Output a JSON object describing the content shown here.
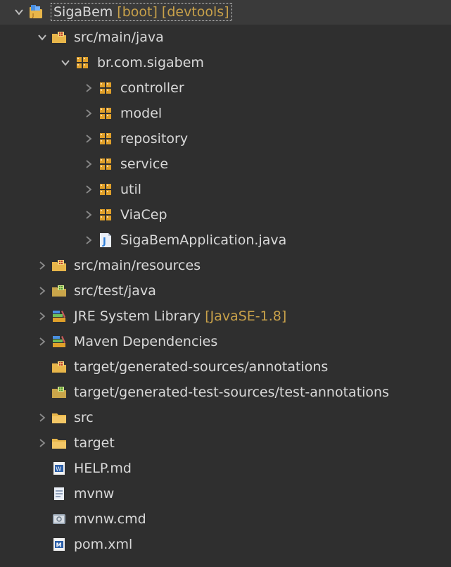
{
  "tree": {
    "nodes": [
      {
        "label": "SigaBem",
        "decoration": "[boot] [devtools]",
        "depth": 0,
        "expand": "open",
        "icon": "project-icon",
        "selected": true
      },
      {
        "label": "src/main/java",
        "decoration": "",
        "depth": 1,
        "expand": "open",
        "icon": "source-folder-icon"
      },
      {
        "label": "br.com.sigabem",
        "decoration": "",
        "depth": 2,
        "expand": "open",
        "icon": "package-icon"
      },
      {
        "label": "controller",
        "decoration": "",
        "depth": 3,
        "expand": "closed",
        "icon": "package-icon"
      },
      {
        "label": "model",
        "decoration": "",
        "depth": 3,
        "expand": "closed",
        "icon": "package-icon"
      },
      {
        "label": "repository",
        "decoration": "",
        "depth": 3,
        "expand": "closed",
        "icon": "package-icon"
      },
      {
        "label": "service",
        "decoration": "",
        "depth": 3,
        "expand": "closed",
        "icon": "package-icon"
      },
      {
        "label": "util",
        "decoration": "",
        "depth": 3,
        "expand": "closed",
        "icon": "package-icon"
      },
      {
        "label": "ViaCep",
        "decoration": "",
        "depth": 3,
        "expand": "closed",
        "icon": "package-icon"
      },
      {
        "label": "SigaBemApplication.java",
        "decoration": "",
        "depth": 3,
        "expand": "closed",
        "icon": "java-file-icon"
      },
      {
        "label": "src/main/resources",
        "decoration": "",
        "depth": 1,
        "expand": "closed",
        "icon": "source-folder-icon"
      },
      {
        "label": "src/test/java",
        "decoration": "",
        "depth": 1,
        "expand": "closed",
        "icon": "test-folder-icon"
      },
      {
        "label": "JRE System Library",
        "decoration": "[JavaSE-1.8]",
        "depth": 1,
        "expand": "closed",
        "icon": "library-icon"
      },
      {
        "label": "Maven Dependencies",
        "decoration": "",
        "depth": 1,
        "expand": "closed",
        "icon": "library-icon"
      },
      {
        "label": "target/generated-sources/annotations",
        "decoration": "",
        "depth": 1,
        "expand": "none",
        "icon": "source-folder-icon"
      },
      {
        "label": "target/generated-test-sources/test-annotations",
        "decoration": "",
        "depth": 1,
        "expand": "none",
        "icon": "test-folder-icon"
      },
      {
        "label": "src",
        "decoration": "",
        "depth": 1,
        "expand": "closed",
        "icon": "folder-icon"
      },
      {
        "label": "target",
        "decoration": "",
        "depth": 1,
        "expand": "closed",
        "icon": "folder-icon"
      },
      {
        "label": "HELP.md",
        "decoration": "",
        "depth": 1,
        "expand": "none",
        "icon": "markdown-file-icon"
      },
      {
        "label": "mvnw",
        "decoration": "",
        "depth": 1,
        "expand": "none",
        "icon": "text-file-icon"
      },
      {
        "label": "mvnw.cmd",
        "decoration": "",
        "depth": 1,
        "expand": "none",
        "icon": "cmd-file-icon"
      },
      {
        "label": "pom.xml",
        "decoration": "",
        "depth": 1,
        "expand": "none",
        "icon": "maven-pom-icon"
      }
    ]
  },
  "colors": {
    "background": "#2f2f2f",
    "text": "#d9d9d9",
    "decoration": "#c8a14a",
    "package": "#e0a02a",
    "folder": "#e8b64a",
    "java": "#2f7fd8"
  }
}
